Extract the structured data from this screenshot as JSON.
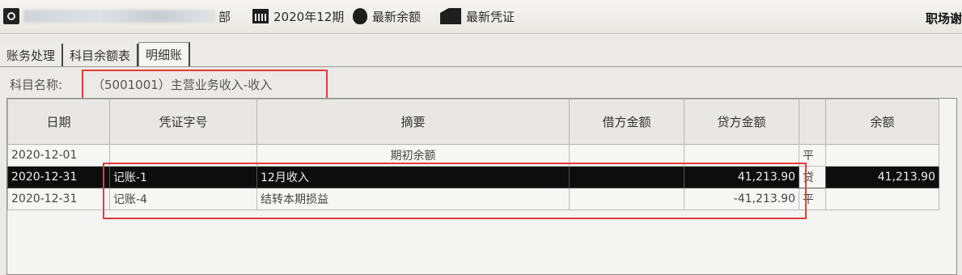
{
  "toolbar": {
    "company_suffix": "部",
    "period": "2020年12期",
    "latest_balance": "最新余额",
    "latest_voucher": "最新凭证",
    "right_title": "职场谢"
  },
  "tabs": [
    {
      "label": "账务处理"
    },
    {
      "label": "科目余额表"
    },
    {
      "label": "明细账"
    }
  ],
  "subject": {
    "label": "科目名称:",
    "value": "（5001001）主营业务收入-收入"
  },
  "ledger": {
    "columns": [
      "日期",
      "凭证字号",
      "摘要",
      "借方金额",
      "贷方金额",
      "",
      "余额"
    ],
    "rows": [
      {
        "date": "2020-12-01",
        "voucher": "",
        "summary": "期初余额",
        "debit": "",
        "credit": "",
        "direction": "平",
        "balance": ""
      },
      {
        "date": "2020-12-31",
        "voucher": "记账-1",
        "summary": "12月收入",
        "debit": "",
        "credit": "41,213.90",
        "direction": "贷",
        "balance": "41,213.90"
      },
      {
        "date": "2020-12-31",
        "voucher": "记账-4",
        "summary": "结转本期损益",
        "debit": "",
        "credit": "-41,213.90",
        "direction": "平",
        "balance": ""
      }
    ]
  },
  "colors": {
    "highlight_box": "#e33c3c",
    "selected_row_bg": "#0d0d0d"
  }
}
